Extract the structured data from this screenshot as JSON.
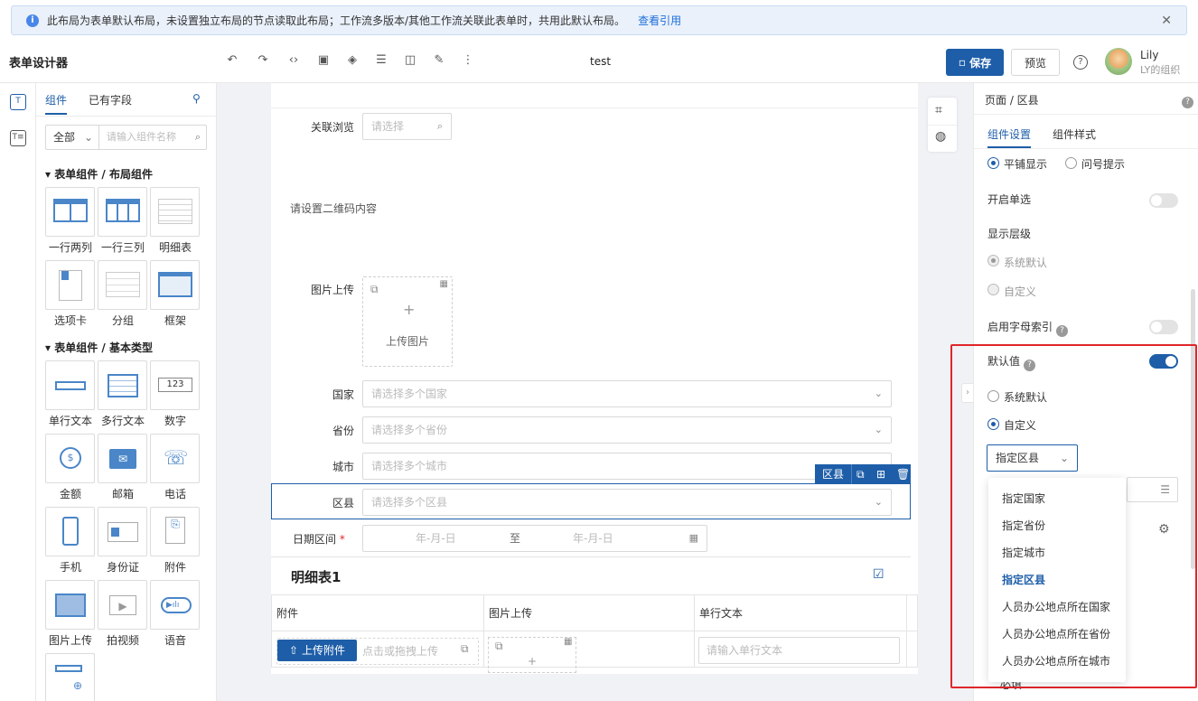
{
  "banner": {
    "info_glyph": "i",
    "text": "此布局为表单默认布局，未设置独立布局的节点读取此布局；工作流多版本/其他工作流关联此表单时，共用此默认布局。",
    "link": "查看引用"
  },
  "header": {
    "title": "表单设计器",
    "doc_name": "test",
    "save_label": "保存",
    "preview_label": "预览",
    "help_glyph": "?",
    "user_name": "Lily",
    "user_org": "LY的组织"
  },
  "rail": {
    "item1": "T",
    "item2": "T≡"
  },
  "library": {
    "tab_components": "组件",
    "tab_fields": "已有字段",
    "filter_value": "全部",
    "search_placeholder": "请输入组件名称",
    "section_layout": "▾ 表单组件 / 布局组件",
    "section_basic": "▾ 表单组件 / 基本类型",
    "layout_items": [
      "一行两列",
      "一行三列",
      "明细表",
      "选项卡",
      "分组",
      "框架"
    ],
    "basic_items": [
      "单行文本",
      "多行文本",
      "数字",
      "金额",
      "邮箱",
      "电话",
      "手机",
      "身份证",
      "附件",
      "图片上传",
      "拍视频",
      "语音"
    ],
    "number_icon_text": "123"
  },
  "form": {
    "assoc_label": "关联浏览",
    "assoc_placeholder": "请选择",
    "qrcode_text": "请设置二维码内容",
    "image_label": "图片上传",
    "image_button": "上传图片",
    "plus_glyph": "+",
    "country_label": "国家",
    "country_placeholder": "请选择多个国家",
    "province_label": "省份",
    "province_placeholder": "请选择多个省份",
    "city_label": "城市",
    "city_placeholder": "请选择多个城市",
    "district_label": "区县",
    "district_placeholder": "请选择多个区县",
    "selected_tag": "区县",
    "daterange_label": "日期区间",
    "required_mark": "*",
    "date_start": "年-月-日",
    "date_sep": "至",
    "date_end": "年-月-日",
    "detail_title": "明细表1",
    "detail_columns": [
      "附件",
      "图片上传",
      "单行文本"
    ],
    "upload_attach": "上传附件",
    "upload_hint": "点击或拖拽上传",
    "text_placeholder": "请输入单行文本"
  },
  "props": {
    "breadcrumb": "页面 / 区县",
    "tab_settings": "组件设置",
    "tab_style": "组件样式",
    "display_tile": "平铺显示",
    "display_question": "问号提示",
    "single_select_label": "开启单选",
    "level_label": "显示层级",
    "level_default": "系统默认",
    "level_custom": "自定义",
    "alpha_index_label": "启用字母索引",
    "default_value_label": "默认值",
    "dv_system": "系统默认",
    "dv_custom": "自定义",
    "dv_select_value": "指定区县",
    "dv_options": [
      "指定国家",
      "指定省份",
      "指定城市",
      "指定区县",
      "人员办公地点所在国家",
      "人员办公地点所在省份",
      "人员办公地点所在城市"
    ],
    "bottom_partial": "必填",
    "help_glyph": "?"
  },
  "colors": {
    "primary": "#1e5ea8",
    "highlight_border": "#e0262a",
    "canvas_bg": "#f0f2f5"
  }
}
